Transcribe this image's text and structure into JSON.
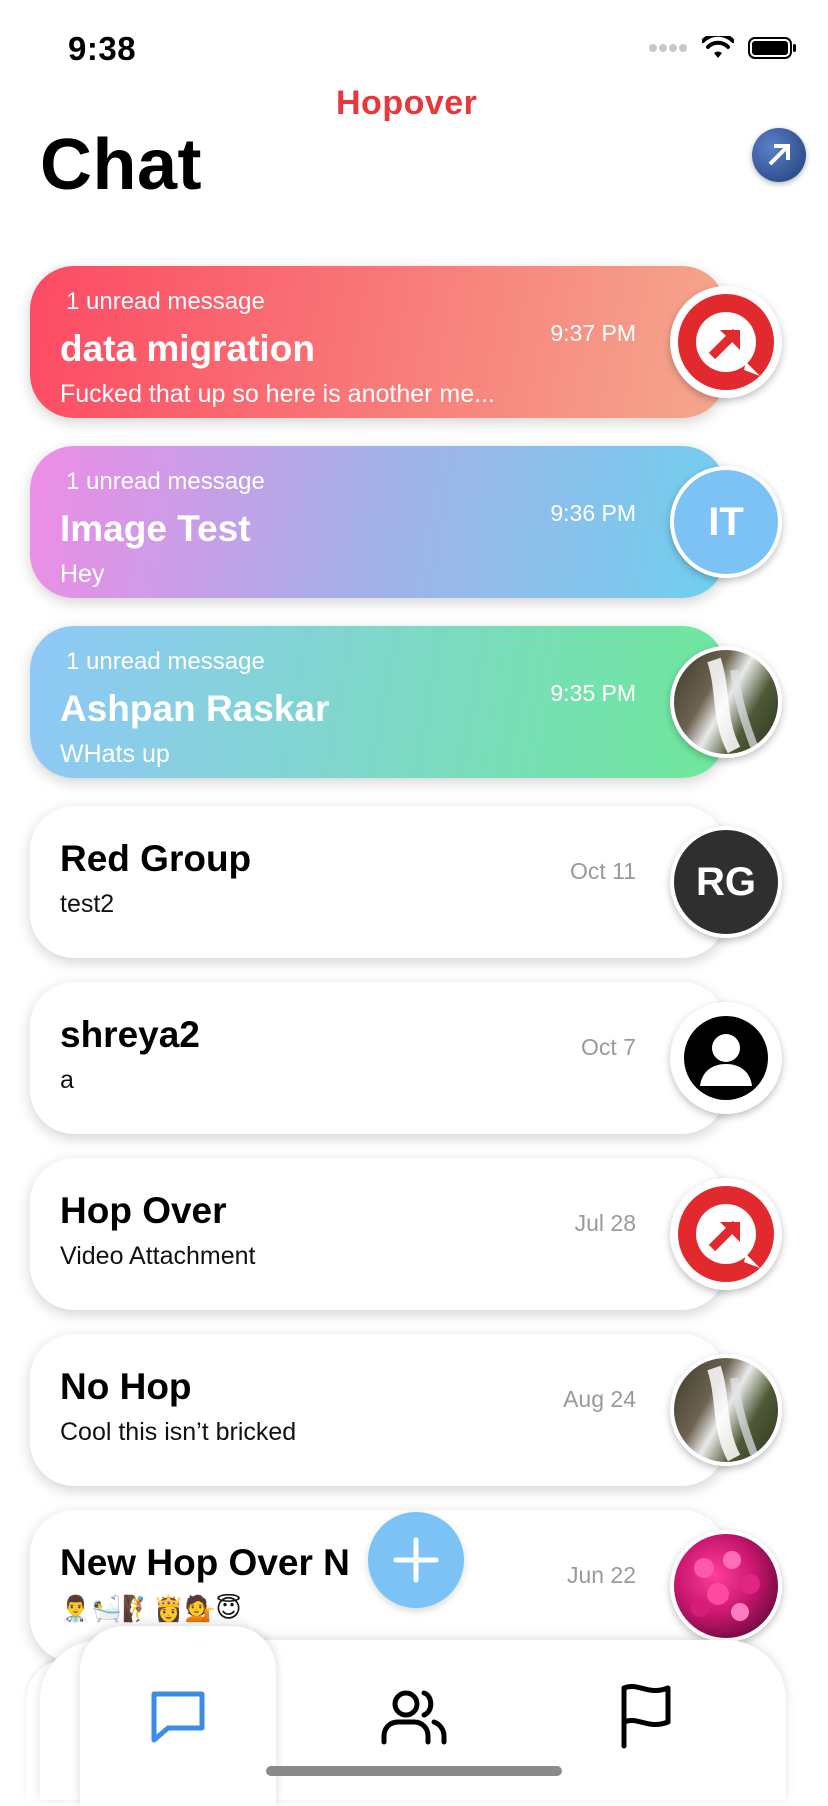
{
  "status_bar": {
    "time": "9:38"
  },
  "brand": {
    "logo_text": "Hopover"
  },
  "header": {
    "title": "Chat"
  },
  "chats": [
    {
      "unread_label": "1 unread message",
      "name": "data migration",
      "preview": "Fucked that up so here is another me...",
      "time": "9:37 PM",
      "avatar": "hopover-logo"
    },
    {
      "unread_label": "1 unread message",
      "name": "Image Test",
      "preview": "Hey",
      "time": "9:36 PM",
      "avatar_initials": "IT"
    },
    {
      "unread_label": "1 unread message",
      "name": "Ashpan Raskar",
      "preview": "WHats up",
      "time": "9:35 PM",
      "avatar": "waterfall-photo"
    },
    {
      "name": "Red Group",
      "preview": "test2",
      "time": "Oct 11",
      "avatar_initials": "RG"
    },
    {
      "name": "shreya2",
      "preview": "a",
      "time": "Oct 7",
      "avatar": "person-silhouette"
    },
    {
      "name": "Hop Over",
      "preview": "Video Attachment",
      "time": "Jul 28",
      "avatar": "hopover-logo"
    },
    {
      "name": "No Hop",
      "preview": "Cool this isn’t bricked",
      "time": "Aug 24",
      "avatar": "waterfall-photo"
    },
    {
      "name": "New Hop Over N",
      "preview": "👨‍⚕️🛀🧗👸💁😇",
      "time": "Jun 22",
      "avatar": "flowers-photo"
    }
  ],
  "colors": {
    "card1_gradient": [
      "#fc4a63",
      "#f5a88e"
    ],
    "card2_gradient": [
      "#ee8ce6",
      "#6fd0ee"
    ],
    "card3_gradient": [
      "#8fc8f8",
      "#6ee89a"
    ],
    "brand_red": "#e8373b",
    "fab": "#7cc2f5",
    "tab_active": "#3c8de6"
  },
  "tabs": [
    {
      "icon": "chat-bubble-icon",
      "active": true
    },
    {
      "icon": "users-icon",
      "active": false
    },
    {
      "icon": "flag-icon",
      "active": false
    }
  ]
}
